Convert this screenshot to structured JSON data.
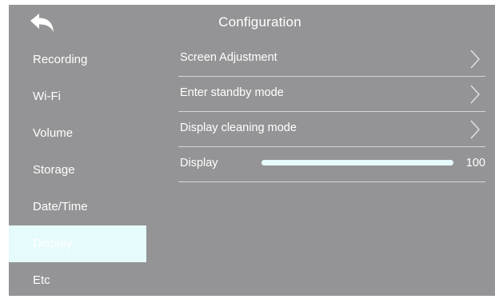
{
  "header": {
    "title": "Configuration",
    "back_icon": "back-arrow-icon"
  },
  "sidebar": {
    "items": [
      {
        "label": "Recording"
      },
      {
        "label": "Wi-Fi"
      },
      {
        "label": "Volume"
      },
      {
        "label": "Storage"
      },
      {
        "label": "Date/Time"
      },
      {
        "label": "Display",
        "selected": true
      },
      {
        "label": "Etc"
      }
    ]
  },
  "main": {
    "items": [
      {
        "label": "Screen Adjustment",
        "icon": "chevron-right-icon"
      },
      {
        "label": "Enter standby mode",
        "icon": "chevron-right-icon"
      },
      {
        "label": "Display cleaning mode",
        "icon": "chevron-right-icon"
      }
    ],
    "brightness": {
      "label": "Display",
      "value": "100",
      "level_percent": 100
    }
  },
  "colors": {
    "background": "#949496",
    "selected_item": "#e6fbfb",
    "slider_fill": "#e6fbfb",
    "divider": "#d6d6d8",
    "text": "#ffffff"
  }
}
